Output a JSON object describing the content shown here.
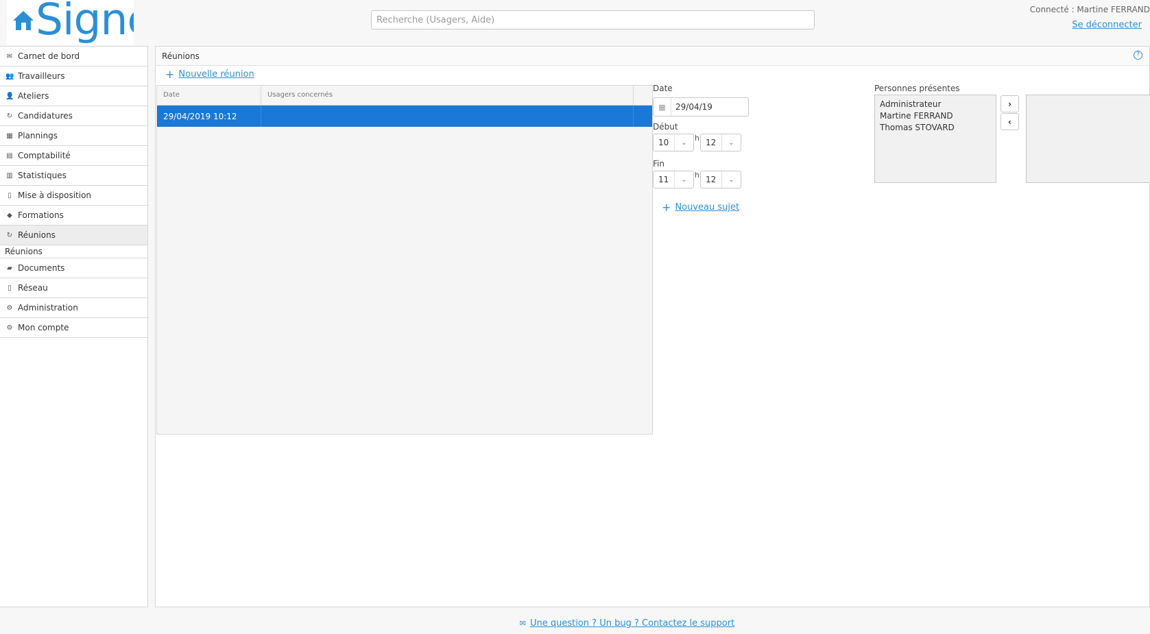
{
  "header": {
    "logo_text": "Signe",
    "search_placeholder": "Recherche (Usagers, Aide)",
    "connected_label": "Connecté : Martine FERRAND",
    "logout_label": "Se déconnecter"
  },
  "sidebar": {
    "items": [
      {
        "label": "Carnet de bord",
        "icon": "envelope-icon"
      },
      {
        "label": "Travailleurs",
        "icon": "users-icon"
      },
      {
        "label": "Ateliers",
        "icon": "worker-icon"
      },
      {
        "label": "Candidatures",
        "icon": "handshake-icon"
      },
      {
        "label": "Plannings",
        "icon": "calendar-icon"
      },
      {
        "label": "Comptabilité",
        "icon": "accounting-icon"
      },
      {
        "label": "Statistiques",
        "icon": "bar-chart-icon"
      },
      {
        "label": "Mise à disposition",
        "icon": "building-icon"
      },
      {
        "label": "Formations",
        "icon": "graduation-cap-icon"
      },
      {
        "label": "Réunions",
        "icon": "handshake-icon"
      }
    ],
    "sub_item": "Réunions",
    "items_after": [
      {
        "label": "Documents",
        "icon": "book-icon"
      },
      {
        "label": "Réseau",
        "icon": "network-icon"
      },
      {
        "label": "Administration",
        "icon": "cogs-icon"
      },
      {
        "label": "Mon compte",
        "icon": "gear-icon"
      }
    ]
  },
  "panel": {
    "title": "Réunions",
    "new_meeting_label": "Nouvelle réunion",
    "grid": {
      "columns": [
        "Date",
        "Usagers concernés",
        ""
      ],
      "rows": [
        {
          "date": "29/04/2019 10:12",
          "users": ""
        }
      ]
    },
    "form": {
      "date_label": "Date",
      "date_value": "29/04/19",
      "start_label": "Début",
      "start_hour": "10",
      "start_minute": "12",
      "end_label": "Fin",
      "end_hour": "11",
      "end_minute": "12",
      "hour_sep": "h",
      "new_subject_label": "Nouveau sujet"
    },
    "persons": {
      "label": "Personnes présentes",
      "available": [
        "Administrateur",
        "Martine FERRAND",
        "Thomas STOVARD"
      ],
      "selected": []
    }
  },
  "footer": {
    "support_label": "Une question ? Un bug ? Contactez le support"
  },
  "colors": {
    "accent": "#2c8fd6",
    "selected_row": "#1a78d6"
  }
}
